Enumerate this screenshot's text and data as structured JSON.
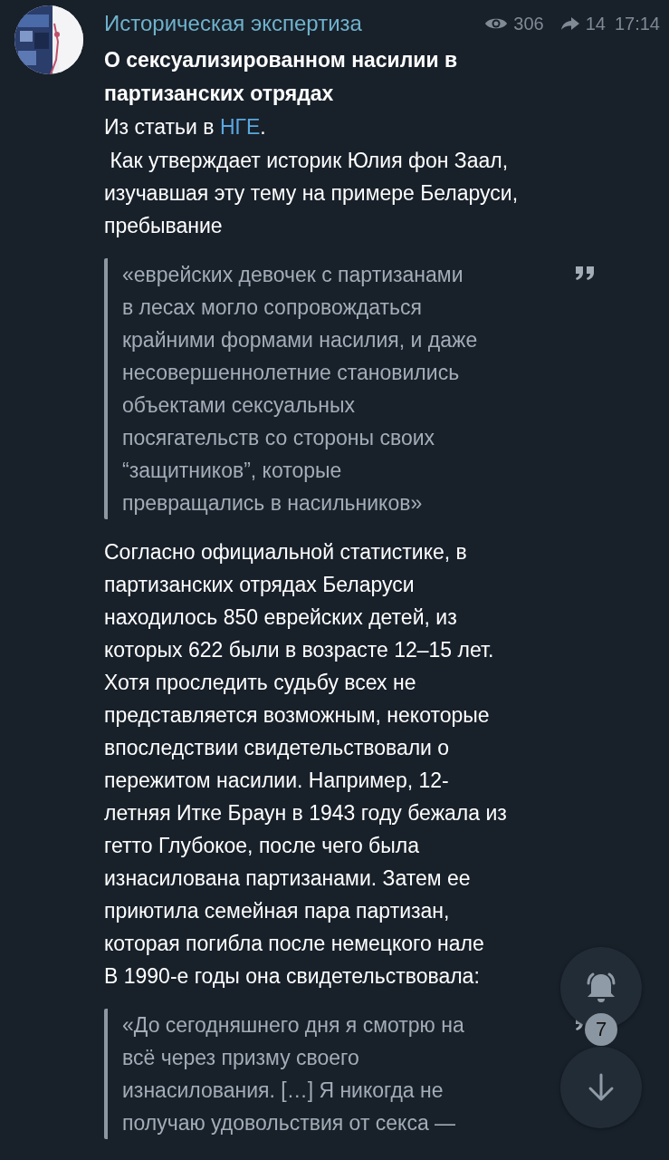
{
  "channel": {
    "name": "Историческая экспертиза",
    "views": "306",
    "shares": "14",
    "time": "17:14"
  },
  "title_lines": [
    "О сексуализированном насилии в",
    "партизанских отрядах"
  ],
  "source": {
    "before": "Из статьи в ",
    "link": "НГЕ",
    "after": "."
  },
  "blocks": [
    {
      "kind": "paragraph",
      "lines": [
        " Как утверждает историк Юлия фон Заал,",
        "изучавшая эту тему на примере Беларуси,",
        "пребывание"
      ]
    },
    {
      "kind": "quote",
      "lines": [
        "«еврейских девочек с партизанами",
        "в лесах могло сопровождаться",
        "крайними формами насилия, и даже",
        "несовершеннолетние становились",
        "объектами сексуальных",
        "посягательств со стороны своих",
        "“защитников”, которые",
        "превращались в насильников»"
      ]
    },
    {
      "kind": "paragraph",
      "lines": [
        "Согласно официальной статистике, в",
        "партизанских отрядах Беларуси",
        "находилось 850 еврейских детей, из",
        "которых 622 были в возрасте 12–15 лет.",
        "Хотя проследить судьбу всех не",
        "представляется возможным, некоторые",
        "впоследствии свидетельствовали о",
        "пережитом насилии. Например, 12-",
        "летняя Итке Браун в 1943 году бежала из",
        "гетто Глубокое, после чего была",
        "изнасилована партизанами. Затем ее",
        "приютила семейная пара партизан,",
        "которая погибла после немецкого нале",
        "В 1990-е годы она свидетельствовала:"
      ]
    },
    {
      "kind": "quote",
      "lines": [
        "«До сегодняшнего дня я смотрю на",
        "всё через призму своего",
        "изнасилования. […] Я никогда не",
        "получаю удовольствия от секса —"
      ]
    }
  ],
  "fabs": [
    {
      "kind": "bell"
    },
    {
      "kind": "down",
      "badge": "7"
    }
  ]
}
